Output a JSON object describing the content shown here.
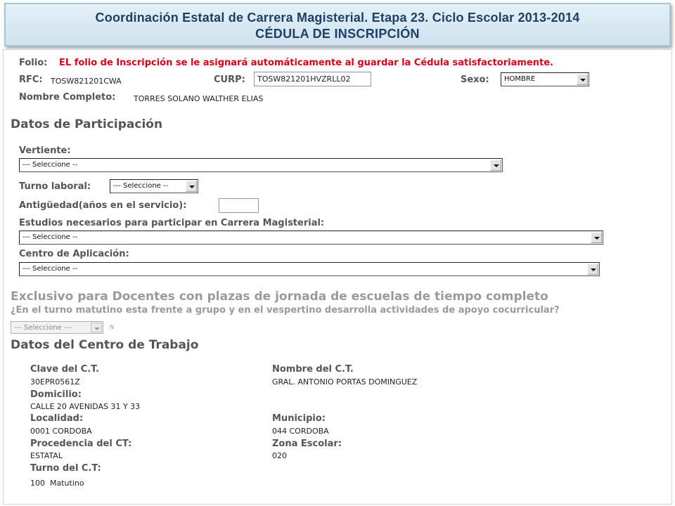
{
  "header": {
    "title_line1": "Coordinación Estatal de Carrera Magisterial. Etapa 23. Ciclo Escolar 2013-2014",
    "title_line2": "CÉDULA DE INSCRIPCIÓN"
  },
  "folio": {
    "label": "Folio:",
    "message": "EL folio de Inscripción se le asignará automáticamente al guardar la Cédula satisfactoriamente."
  },
  "personal": {
    "rfc_label": "RFC:",
    "rfc_value": "TOSW821201CWA",
    "curp_label": "CURP:",
    "curp_value": "TOSW821201HVZRLL02",
    "sexo_label": "Sexo:",
    "sexo_value": "HOMBRE",
    "nombre_label": "Nombre Completo:",
    "nombre_value": "TORRES SOLANO WALTHER ELIAS"
  },
  "participacion": {
    "section_title": "Datos de Participación",
    "vertiente_label": "Vertiente:",
    "vertiente_value": "--- Seleccione --",
    "turno_label": "Turno laboral:",
    "turno_value": "--- Seleccione --",
    "antiguedad_label": "Antigüedad(años en el servicio):",
    "antiguedad_value": "",
    "estudios_label": "Estudios necesarios para participar en Carrera Magisterial:",
    "estudios_value": "--- Seleccione --",
    "centro_label": "Centro de Aplicación:",
    "centro_value": "--- Seleccione --"
  },
  "exclusivo": {
    "section_title": "Exclusivo para Docentes con plazas de jornada de escuelas de tiempo completo",
    "question": "¿En el turno matutino esta frente a grupo y en el vespertino desarrolla actividades de apoyo cocurricular?",
    "select_value": "--- Seleccione ---",
    "hint": "N"
  },
  "centro_trabajo": {
    "section_title": "Datos del Centro de Trabajo",
    "clave_label": "Clave del C.T.",
    "clave_value": "30EPR0561Z",
    "nombre_label": "Nombre del C.T.",
    "nombre_value": "GRAL. ANTONIO PORTAS DOMINGUEZ",
    "domicilio_label": "Domicilio:",
    "domicilio_value": "CALLE 20 AVENIDAS 31 Y 33",
    "localidad_label": "Localidad:",
    "localidad_value": "0001 CORDOBA",
    "municipio_label": "Municipio:",
    "municipio_value": "044 CORDOBA",
    "procedencia_label": "Procedencia del CT:",
    "procedencia_value": "ESTATAL",
    "zona_label": "Zona Escolar:",
    "zona_value": "020",
    "turno_label": "Turno del C.T:",
    "turno_value": "100  Matutino"
  },
  "colors": {
    "banner_text": "#1f3f66",
    "banner_bg": "#d9e8f2",
    "label_gray": "#555555",
    "alert_red": "#e0001b",
    "disabled_gray": "#9a9a9a"
  }
}
